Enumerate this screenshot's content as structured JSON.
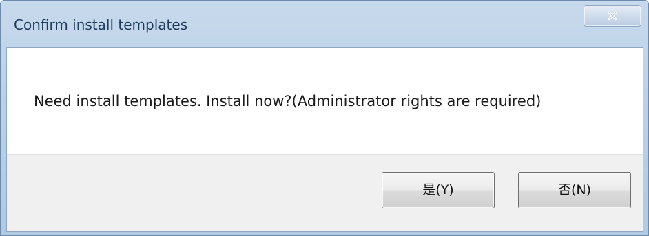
{
  "window": {
    "title": "Confirm install templates"
  },
  "icons": {
    "close": "close-icon"
  },
  "dialog": {
    "message": "Need install templates. Install now?(Administrator rights are required)",
    "yes_label": "是(Y)",
    "no_label": "否(N)"
  },
  "colors": {
    "titlebar": "#bcd1e8",
    "title_text": "#1e3a5c",
    "button_area": "#f0f0f0"
  }
}
